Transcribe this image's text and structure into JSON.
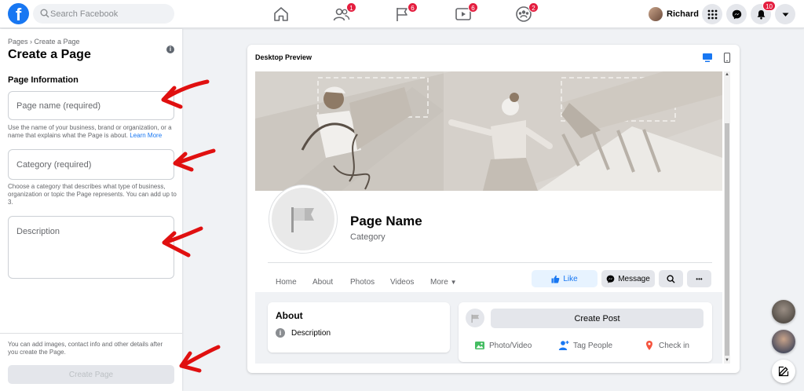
{
  "search": {
    "placeholder": "Search Facebook"
  },
  "nav": {
    "friends_badge": "1",
    "pages_badge": "6",
    "watch_badge": "6",
    "groups_badge": "2"
  },
  "profile": {
    "name": "Richard"
  },
  "notifications": {
    "badge": "10"
  },
  "left": {
    "breadcrumb": "Pages › Create a Page",
    "title": "Create a Page",
    "section": "Page Information",
    "name_placeholder": "Page name (required)",
    "name_help": "Use the name of your business, brand or organization, or a name that explains what the Page is about.",
    "learn_more": "Learn More",
    "category_placeholder": "Category (required)",
    "category_help": "Choose a category that describes what type of business, organization or topic the Page represents. You can add up to 3.",
    "description_placeholder": "Description",
    "footer_text": "You can add images, contact info and other details after you create the Page.",
    "create_button": "Create Page"
  },
  "preview": {
    "title": "Desktop Preview",
    "page_name": "Page Name",
    "category": "Category",
    "tabs": [
      "Home",
      "About",
      "Photos",
      "Videos",
      "More"
    ],
    "like_button": "Like",
    "message_button": "Message",
    "more_dots": "•••",
    "about_heading": "About",
    "about_description": "Description",
    "create_post": "Create Post",
    "actions": [
      "Photo/Video",
      "Tag People",
      "Check in"
    ]
  },
  "colors": {
    "brand": "#1877f2",
    "badge": "#e41e3f",
    "arrow": "#e01010"
  }
}
